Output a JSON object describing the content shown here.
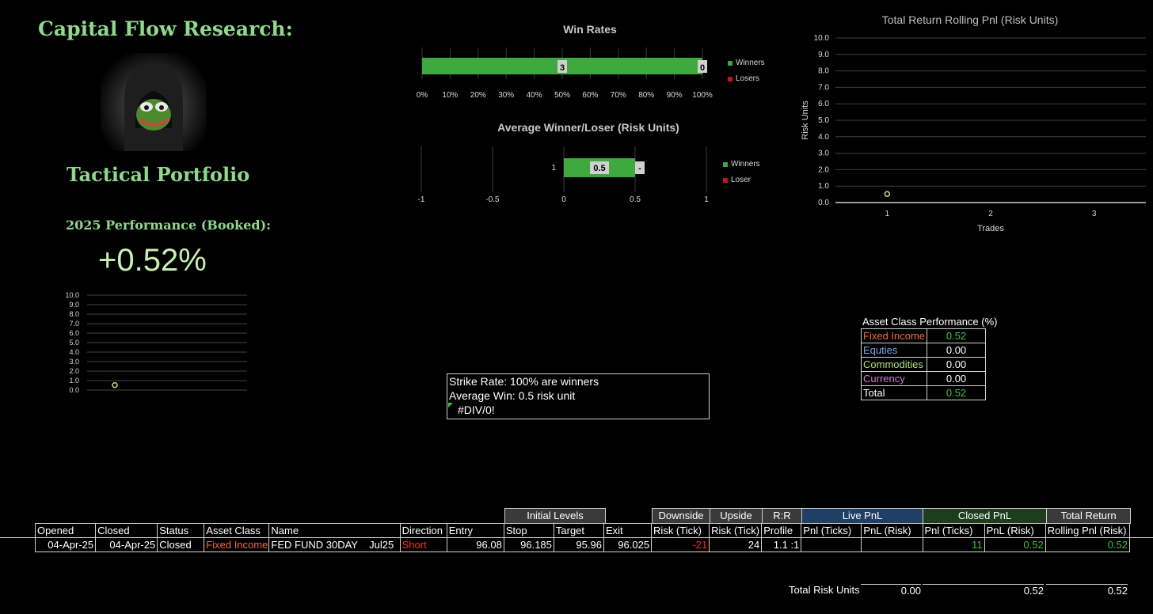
{
  "branding": {
    "title": "Capital Flow Research:",
    "subtitle": "Tactical Portfolio",
    "perf_label": "2025 Performance (Booked):",
    "perf_value": "+0.52%"
  },
  "mini_chart": {
    "y_ticks": [
      "10.0",
      "9.0",
      "8.0",
      "7.0",
      "6.0",
      "5.0",
      "4.0",
      "3.0",
      "2.0",
      "1.0",
      "0.0"
    ],
    "ylim": [
      0,
      10
    ],
    "points": [
      0.52
    ]
  },
  "win_rates": {
    "title": "Win Rates",
    "x_ticks": [
      "0%",
      "10%",
      "20%",
      "30%",
      "40%",
      "50%",
      "60%",
      "70%",
      "80%",
      "90%",
      "100%"
    ],
    "winners_label": "3",
    "losers_label": "0",
    "winners_pct": 100,
    "legend": [
      "Winners",
      "Losers"
    ]
  },
  "avg_chart": {
    "title": "Average Winner/Loser (Risk Units)",
    "category": "1",
    "x_ticks": [
      "-1",
      "-0.5",
      "0",
      "0.5",
      "1"
    ],
    "xlim": [
      -1,
      1
    ],
    "winner_value": 0.5,
    "winner_label": "0.5",
    "loser_label": "-",
    "legend": [
      "Winners",
      "Loser"
    ]
  },
  "rolling_chart": {
    "title": "Total Return Rolling Pnl (Risk Units)",
    "ylabel": "Risk Units",
    "xlabel": "Trades",
    "y_ticks": [
      "10.0",
      "9.0",
      "8.0",
      "7.0",
      "6.0",
      "5.0",
      "4.0",
      "3.0",
      "2.0",
      "1.0",
      "0.0"
    ],
    "x_ticks": [
      "1",
      "2",
      "3"
    ],
    "ylim": [
      0,
      10
    ],
    "points": [
      {
        "x": 1,
        "y": 0.52
      }
    ]
  },
  "colors": {
    "winners": "#3fa83f",
    "losers": "#c0161b",
    "title_green": "#8fd98a",
    "live_header": "#1f3f66",
    "closed_header": "#1d3d1d"
  },
  "asset_class": {
    "title": "Asset Class Performance (%)",
    "rows": [
      {
        "name": "Fixed Income",
        "value": "0.52"
      },
      {
        "name": "Equties",
        "value": "0.00"
      },
      {
        "name": "Commodities",
        "value": "0.00"
      },
      {
        "name": "Currency",
        "value": "0.00"
      },
      {
        "name": "Total",
        "value": "0.52"
      }
    ]
  },
  "summary_box": {
    "line1": "Strike Rate: 100% are winners",
    "line2": "Average Win: 0.5 risk unit",
    "line3": "#DIV/0!"
  },
  "trade_table": {
    "group_headers": {
      "initial_levels": "Initial Levels",
      "downside": "Downside",
      "upside": "Upside",
      "rr": "R:R",
      "live_pnl": "Live PnL",
      "closed_pnl": "Closed PnL",
      "total_return": "Total Return"
    },
    "columns": [
      "Opened",
      "Closed",
      "Status",
      "Asset Class",
      "Name",
      "Direction",
      "Entry",
      "Stop",
      "Target",
      "Exit",
      "Risk (Tick)",
      "Risk (Tick)",
      "Profile",
      "Pnl (Ticks)",
      "PnL (Risk)",
      "Pnl (Ticks)",
      "PnL (Risk)",
      "Rolling Pnl (Risk)"
    ],
    "row": {
      "opened": "04-Apr-25",
      "closed": "04-Apr-25",
      "status": "Closed",
      "asset_class": "Fixed Income",
      "name": "FED FUND 30DAY    Jul25",
      "direction": "Short",
      "entry": "96.08",
      "stop": "96.185",
      "target": "95.96",
      "exit": "96.025",
      "risk_down": "-21",
      "risk_up": "24",
      "profile": "1.1 :1",
      "live_ticks": "",
      "live_risk": "",
      "closed_ticks": "11",
      "closed_risk": "0.52",
      "rolling": "0.52"
    }
  },
  "totals": {
    "label": "Total Risk Units",
    "live": "0.00",
    "closed": "0.52",
    "rolling": "0.52"
  }
}
